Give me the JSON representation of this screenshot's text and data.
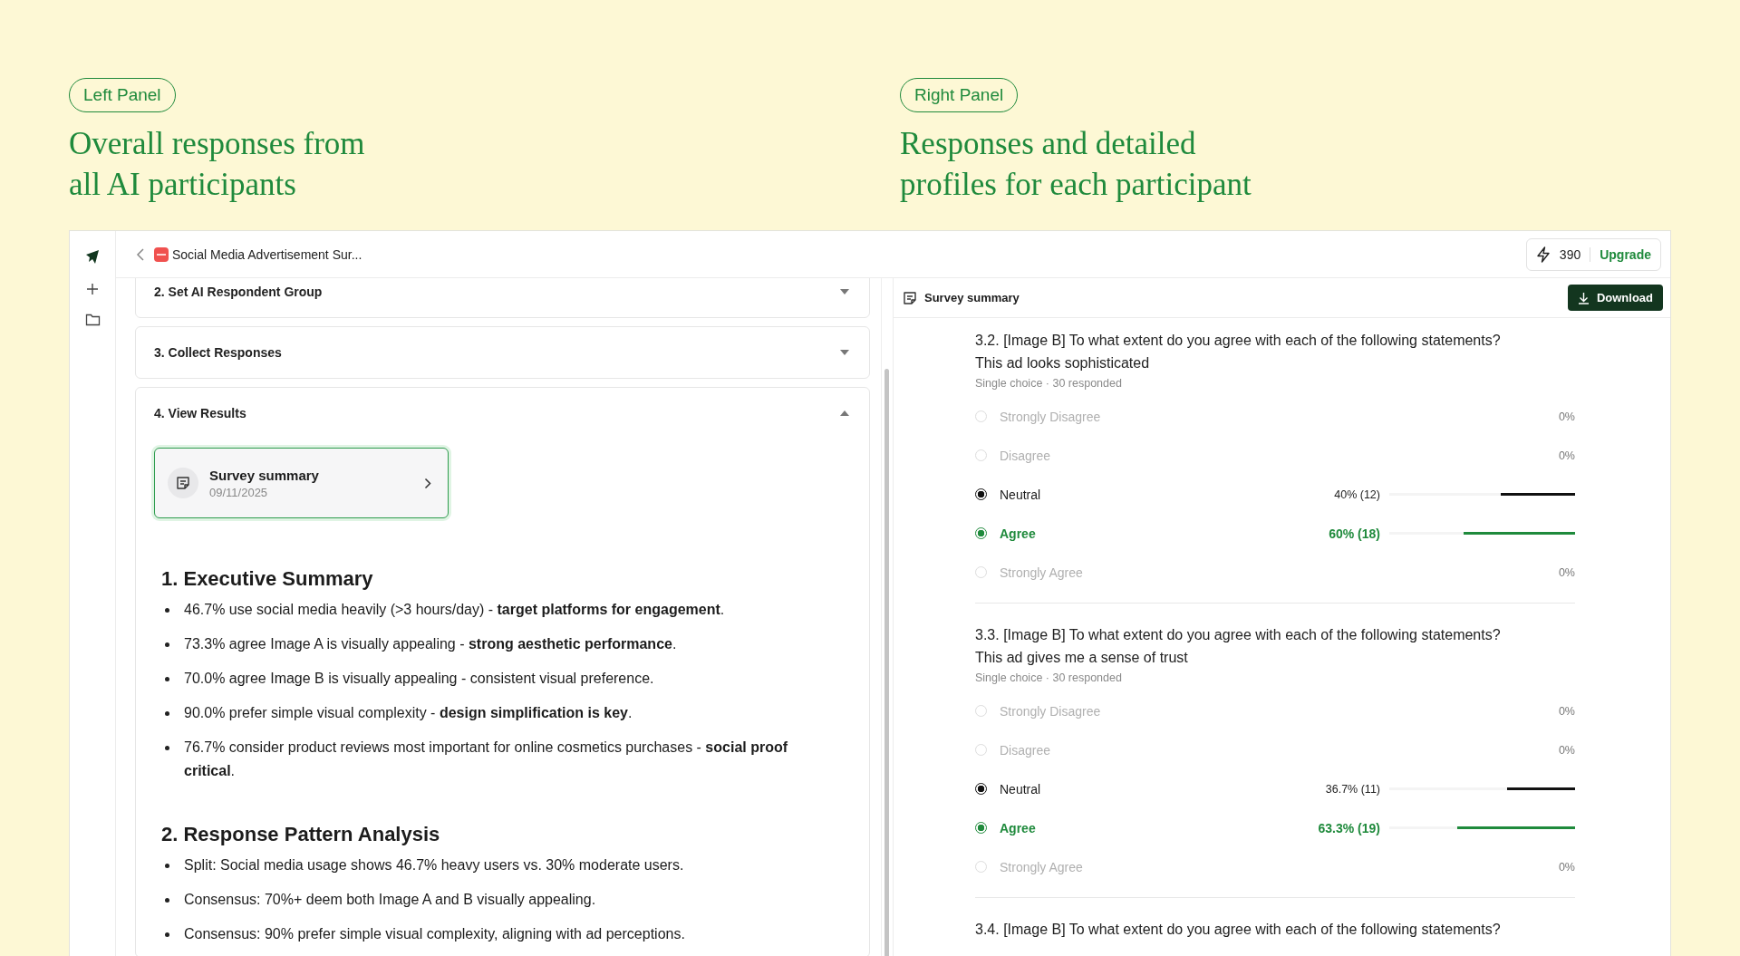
{
  "intro": [
    {
      "pill": "Left Panel",
      "heading": "Overall responses from all AI participants"
    },
    {
      "pill": "Right Panel",
      "heading": "Responses and detailed profiles for each participant"
    }
  ],
  "topbar": {
    "document_title": "Social Media Advertisement Sur...",
    "credits": "390",
    "upgrade": "Upgrade"
  },
  "steps": [
    {
      "label": "2. Set AI Respondent Group",
      "expanded": false
    },
    {
      "label": "3. Collect Responses",
      "expanded": false
    },
    {
      "label": "4. View Results",
      "expanded": true
    }
  ],
  "summary_card": {
    "title": "Survey summary",
    "date": "09/11/2025",
    "selected": true
  },
  "report": [
    {
      "heading": "1. Executive Summary",
      "bullets": [
        "46.7% use social media heavily (>3 hours/day) - **target platforms for engagement**.",
        "73.3% agree Image A is visually appealing - **strong aesthetic performance**.",
        "70.0% agree Image B is visually appealing - consistent visual preference.",
        "90.0% prefer simple visual complexity - **design simplification is key**.",
        "76.7% consider product reviews most important for online cosmetics purchases - **social proof critical**."
      ]
    },
    {
      "heading": "2. Response Pattern Analysis",
      "bullets": [
        "Split: Social media usage shows 46.7% heavy users vs. 30% moderate users.",
        "Consensus: 70%+ deem both Image A and B visually appealing.",
        "Consensus: 90% prefer simple visual complexity, aligning with ad perceptions."
      ]
    }
  ],
  "right_panel": {
    "title": "Survey summary",
    "download": "Download"
  },
  "questions": [
    {
      "title": "3.2. [Image B] To what extent do you agree with each of the following statements?",
      "statement": "This ad looks sophisticated",
      "meta": "Single choice · 30 responded",
      "options": [
        {
          "label": "Strongly Disagree",
          "reading": "0%",
          "kind": "empty"
        },
        {
          "label": "Disagree",
          "reading": "0%",
          "kind": "empty"
        },
        {
          "label": "Neutral",
          "reading": "40% (12)",
          "level": 0.4,
          "kind": "answer"
        },
        {
          "label": "Agree",
          "reading": "60% (18)",
          "level": 0.6,
          "kind": "top"
        },
        {
          "label": "Strongly Agree",
          "reading": "0%",
          "kind": "empty"
        }
      ]
    },
    {
      "title": "3.3. [Image B] To what extent do you agree with each of the following statements?",
      "statement": "This ad gives me a sense of trust",
      "meta": "Single choice · 30 responded",
      "options": [
        {
          "label": "Strongly Disagree",
          "reading": "0%",
          "kind": "empty"
        },
        {
          "label": "Disagree",
          "reading": "0%",
          "kind": "empty"
        },
        {
          "label": "Neutral",
          "reading": "36.7% (11)",
          "level": 0.367,
          "kind": "answer"
        },
        {
          "label": "Agree",
          "reading": "63.3% (19)",
          "level": 0.633,
          "kind": "top"
        },
        {
          "label": "Strongly Agree",
          "reading": "0%",
          "kind": "empty"
        }
      ]
    },
    {
      "title": "3.4. [Image B] To what extent do you agree with each of the following statements?"
    }
  ]
}
